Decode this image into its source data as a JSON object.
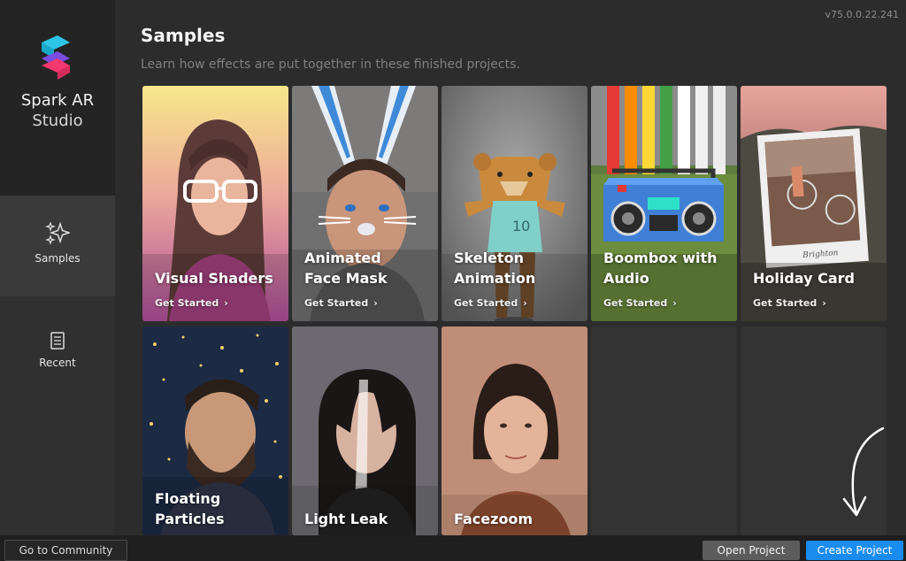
{
  "app": {
    "name": "Spark AR",
    "subtitle": "Studio",
    "version": "v75.0.0.22.241"
  },
  "sidebar": {
    "items": [
      {
        "label": "Samples",
        "icon": "sparkles-icon",
        "selected": true
      },
      {
        "label": "Recent",
        "icon": "document-icon",
        "selected": false
      }
    ]
  },
  "main": {
    "title": "Samples",
    "subtitle": "Learn how effects are put together in these finished projects."
  },
  "cards": [
    {
      "title_line1": "Visual Shaders",
      "title_line2": "",
      "link": "Get Started"
    },
    {
      "title_line1": "Animated",
      "title_line2": "Face Mask",
      "link": "Get Started"
    },
    {
      "title_line1": "Skeleton",
      "title_line2": "Animation",
      "link": "Get Started"
    },
    {
      "title_line1": "Boombox with",
      "title_line2": "Audio",
      "link": "Get Started"
    },
    {
      "title_line1": "Holiday Card",
      "title_line2": "",
      "link": "Get Started"
    },
    {
      "title_line1": "Floating",
      "title_line2": "Particles",
      "link": ""
    },
    {
      "title_line1": "Light Leak",
      "title_line2": "",
      "link": ""
    },
    {
      "title_line1": "Facezoom",
      "title_line2": "",
      "link": ""
    }
  ],
  "holiday_card_caption": "Brighton",
  "bear_jersey_number": "10",
  "footer": {
    "community": "Go to Community",
    "open_project": "Open Project",
    "create_project": "Create Project"
  },
  "colors": {
    "accent": "#1a8cf0",
    "sidebar": "#303030",
    "background": "#2c2c2c"
  }
}
